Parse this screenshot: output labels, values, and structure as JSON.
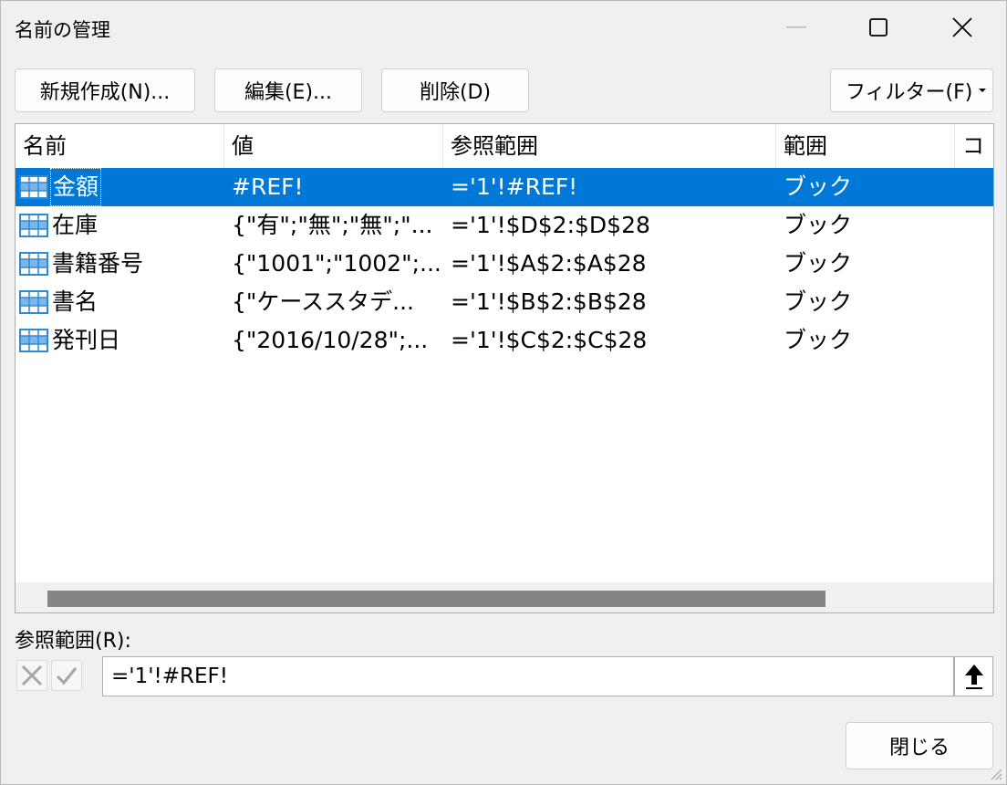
{
  "window": {
    "title": "名前の管理"
  },
  "toolbar": {
    "new_label": "新規作成(N)...",
    "edit_label": "編集(E)...",
    "delete_label": "削除(D)",
    "filter_label": "フィルター(F)"
  },
  "list": {
    "columns": [
      "名前",
      "値",
      "参照範囲",
      "範囲",
      "コ"
    ],
    "rows": [
      {
        "name": "金額",
        "value": "#REF!",
        "refers_to": "='1'!#REF!",
        "scope": "ブック",
        "selected": true
      },
      {
        "name": "在庫",
        "value": "{\"有\";\"無\";\"無\";\"...",
        "refers_to": "='1'!$D$2:$D$28",
        "scope": "ブック",
        "selected": false
      },
      {
        "name": "書籍番号",
        "value": "{\"1001\";\"1002\";...",
        "refers_to": "='1'!$A$2:$A$28",
        "scope": "ブック",
        "selected": false
      },
      {
        "name": "書名",
        "value": "{\"ケーススタデ...",
        "refers_to": "='1'!$B$2:$B$28",
        "scope": "ブック",
        "selected": false
      },
      {
        "name": "発刊日",
        "value": "{\"2016/10/28\";...",
        "refers_to": "='1'!$C$2:$C$28",
        "scope": "ブック",
        "selected": false
      }
    ]
  },
  "refers_to_section": {
    "label": "参照範囲(R):",
    "value": "='1'!#REF!"
  },
  "footer": {
    "close_label": "閉じる"
  },
  "colors": {
    "selection": "#0078d7",
    "icon_blue": "#2e8ad8"
  }
}
